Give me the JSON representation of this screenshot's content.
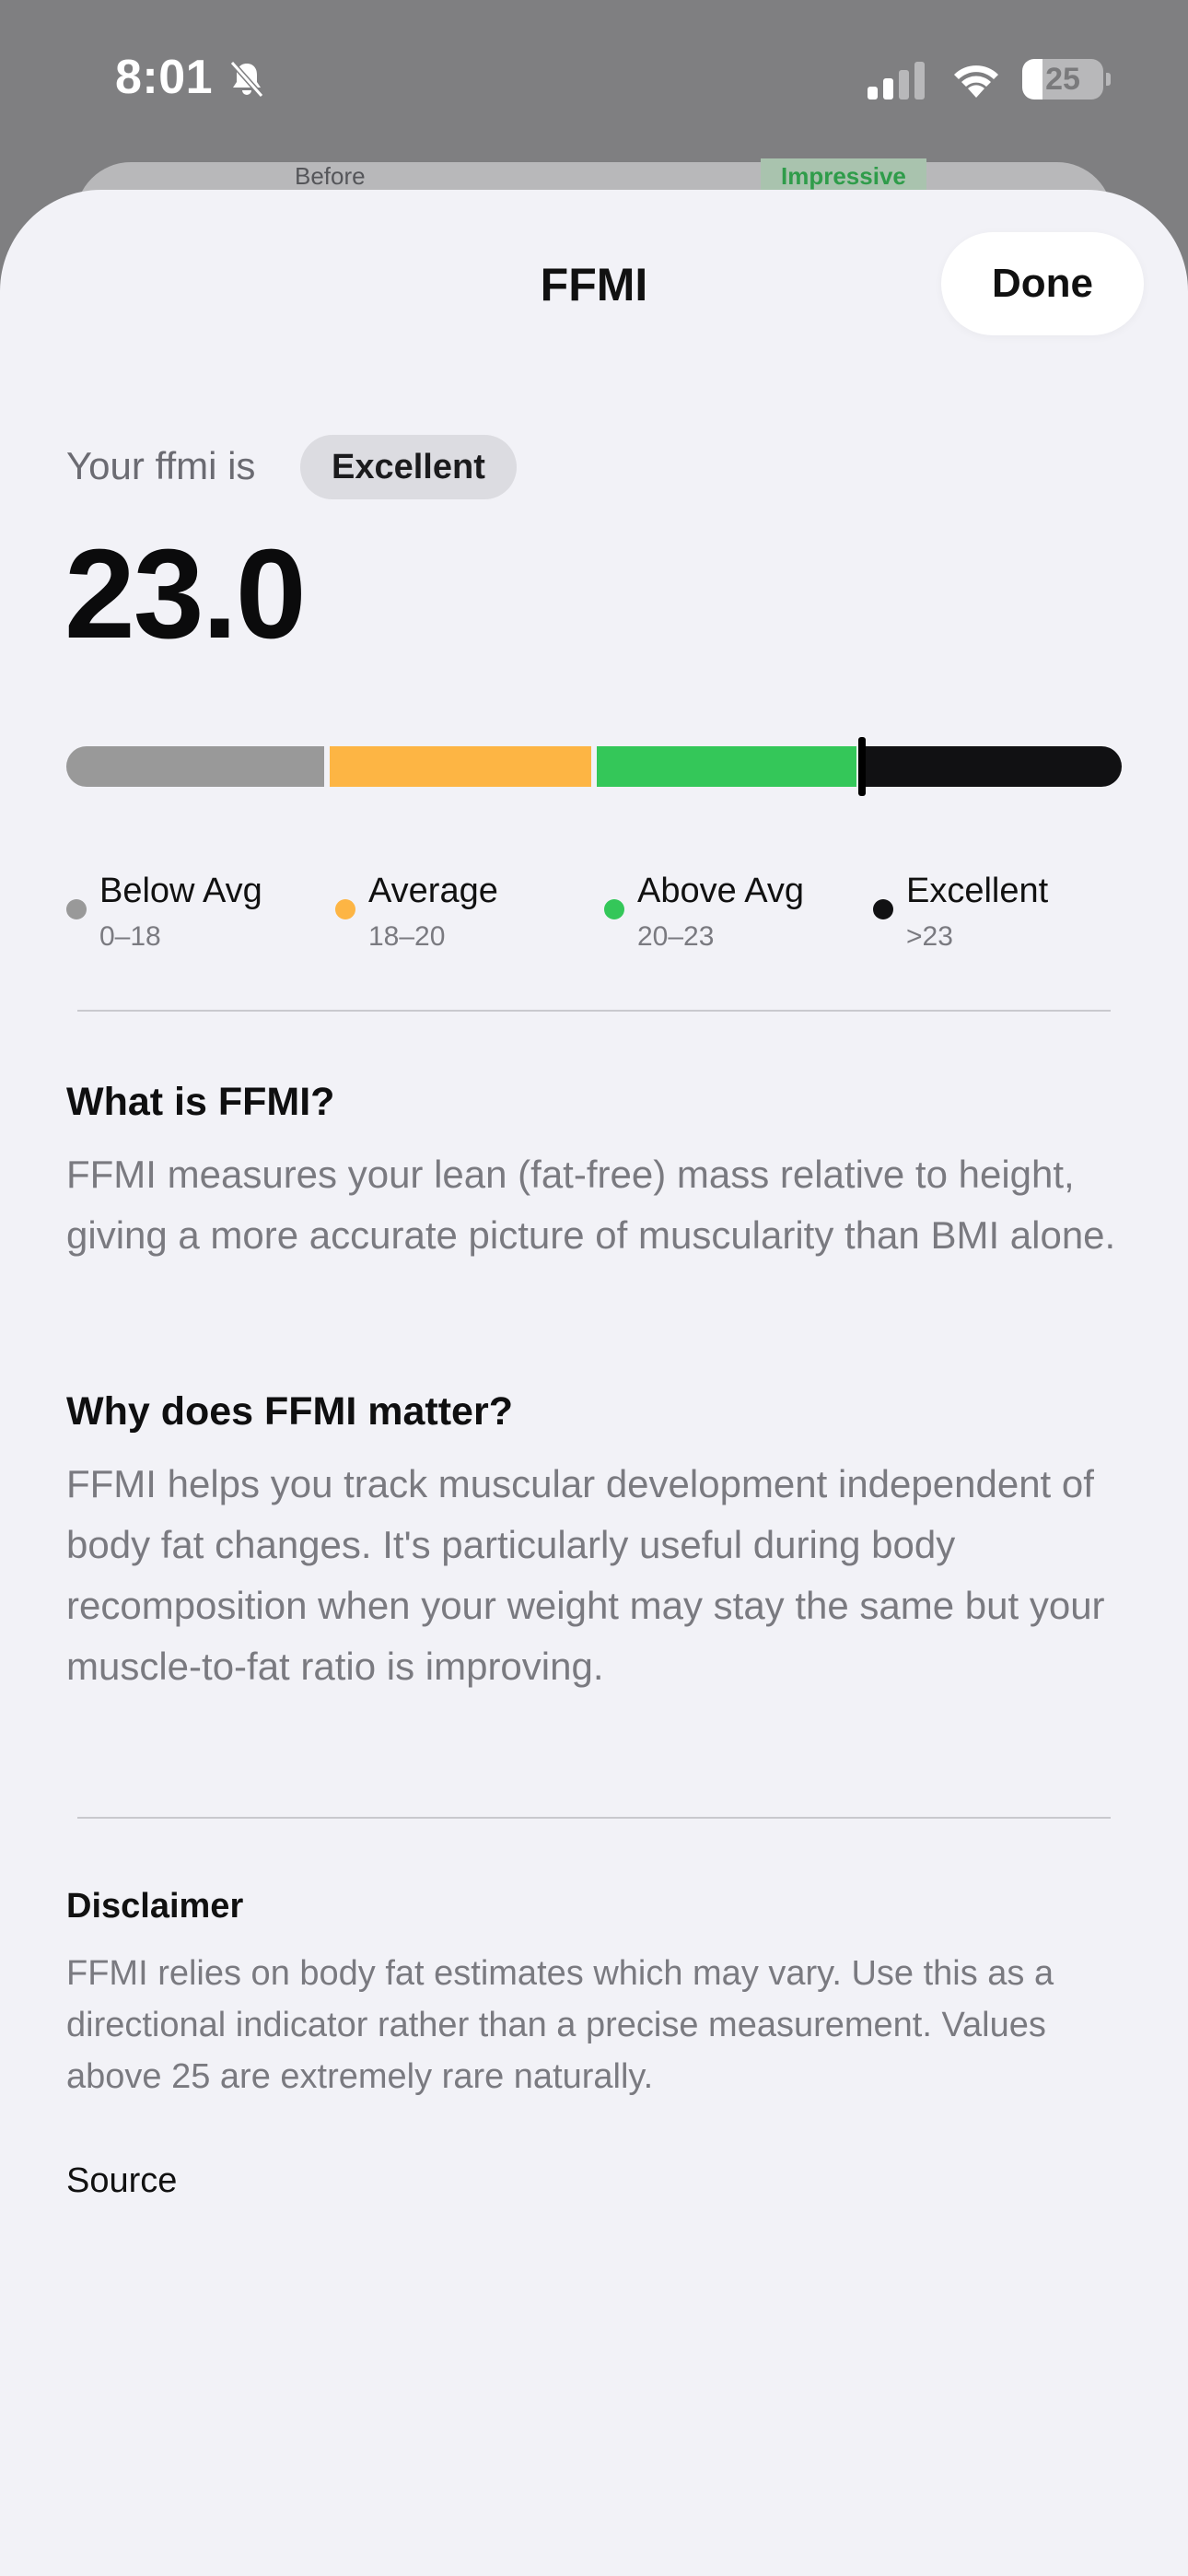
{
  "status_bar": {
    "time": "8:01",
    "battery_level": "25",
    "battery_fraction": 0.25
  },
  "background": {
    "left_label": "Before",
    "right_label": "Impressive"
  },
  "sheet": {
    "title": "FFMI",
    "done_label": "Done"
  },
  "metric": {
    "prefix": "Your ffmi is",
    "rating": "Excellent",
    "value": "23.0",
    "numeric_value": 23.0,
    "scale_min": 16,
    "scale_max": 26
  },
  "scale": {
    "segments": [
      {
        "label": "Below Avg",
        "range": "0–18",
        "color": "#999999"
      },
      {
        "label": "Average",
        "range": "18–20",
        "color": "#fdb544"
      },
      {
        "label": "Above Avg",
        "range": "20–23",
        "color": "#34c759"
      },
      {
        "label": "Excellent",
        "range": ">23",
        "color": "#111113"
      }
    ],
    "marker_fraction": 0.754
  },
  "sections": [
    {
      "title": "What is FFMI?",
      "body": "FFMI measures your lean (fat-free) mass relative to height, giving a more accurate picture of muscularity than BMI alone."
    },
    {
      "title": "Why does FFMI matter?",
      "body": "FFMI helps you track muscular development independent of body fat changes. It's particularly useful during body recomposition when your weight may stay the same but your muscle-to-fat ratio is improving."
    }
  ],
  "disclaimer": {
    "title": "Disclaimer",
    "body": "FFMI relies on body fat estimates which may vary. Use this as a directional indicator rather than a precise measurement. Values above 25 are extremely rare naturally."
  },
  "source_label": "Source"
}
